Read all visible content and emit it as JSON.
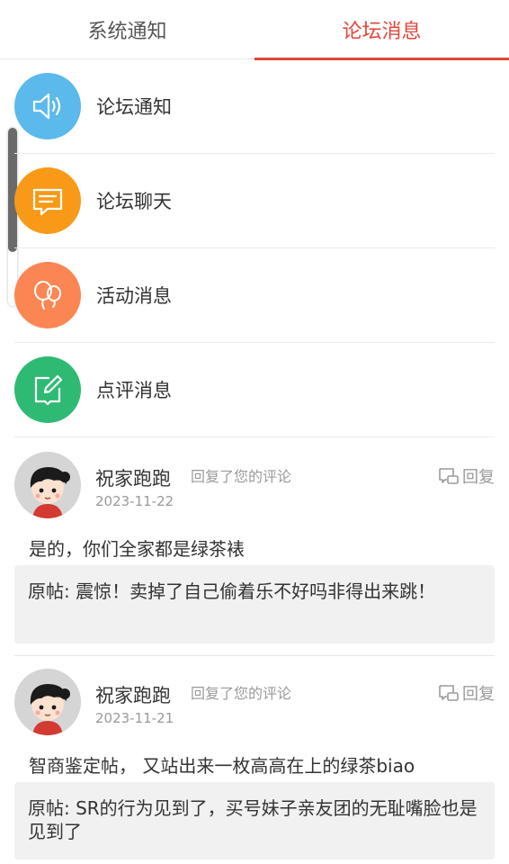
{
  "tabs": [
    {
      "label": "系统通知",
      "active": false
    },
    {
      "label": "论坛消息",
      "active": true
    }
  ],
  "accent_color": "#e2463b",
  "menu": [
    {
      "label": "论坛通知",
      "icon": "speaker-icon",
      "color": "#5bb9ec"
    },
    {
      "label": "论坛聊天",
      "icon": "chat-icon",
      "color": "#f89a17"
    },
    {
      "label": "活动消息",
      "icon": "balloon-icon",
      "color": "#fb8653"
    },
    {
      "label": "点评消息",
      "icon": "edit-icon",
      "color": "#2fba74"
    }
  ],
  "comments": [
    {
      "name": "祝家跑跑",
      "action": "回复了您的评论",
      "date": "2023-11-22",
      "reply_label": "回复",
      "text": "是的，你们全家都是绿茶裱",
      "original": "原帖: 震惊！卖掉了自己偷着乐不好吗非得出来跳！"
    },
    {
      "name": "祝家跑跑",
      "action": "回复了您的评论",
      "date": "2023-11-21",
      "reply_label": "回复",
      "text": "智商鉴定帖，  又站出来一枚高高在上的绿茶biao",
      "original": "原帖: SR的行为见到了，买号妹子亲友团的无耻嘴脸也是见到了"
    }
  ]
}
